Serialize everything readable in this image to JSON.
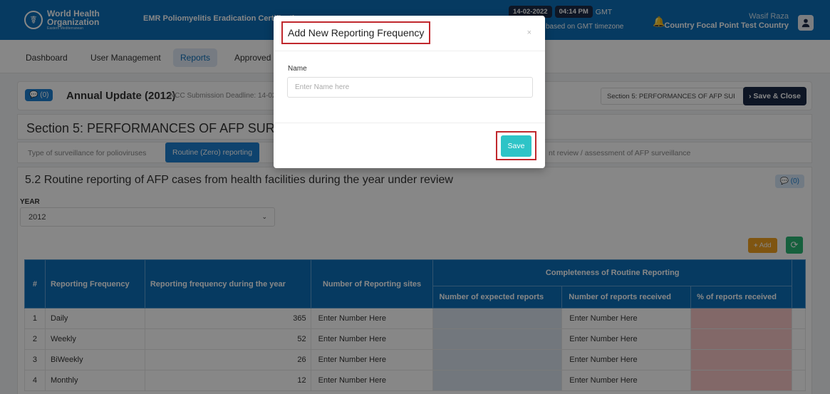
{
  "header": {
    "org_line1": "World Health",
    "org_line2": "Organization",
    "org_line3": "Eastern Mediterranean",
    "app_title": "EMR Poliomyelitis Eradication Certificatio",
    "date": "14-02-2022",
    "time": "04:14 PM",
    "tz": "GMT",
    "tz_note": "based on GMT timezone",
    "user_name": "Wasif Raza",
    "user_role": "Country Focal Point Test Country"
  },
  "nav": {
    "dashboard": "Dashboard",
    "user_management": "User Management",
    "reports": "Reports",
    "approved": "Approved R"
  },
  "report": {
    "comments_badge": "(0)",
    "title": "Annual Update (2012)",
    "deadline": "NCC Submission Deadline: 14-02",
    "section_select": "Section 5: PERFORMANCES OF AFP SUI",
    "save_close": "Save & Close",
    "section_title": "Section 5: PERFORMANCES OF AFP SURVEI",
    "tabs": {
      "t1": "Type of surveillance for polioviruses",
      "t2": "Routine (Zero) reporting",
      "t3": "nt review / assessment of AFP surveillance"
    }
  },
  "panel": {
    "title": "5.2 Routine reporting of AFP cases from health facilities during the year under review",
    "badge": "(0)",
    "year_label": "YEAR",
    "year_value": "2012",
    "add_label": "Add"
  },
  "table": {
    "headers": {
      "num": "#",
      "freq": "Reporting Frequency",
      "during": "Reporting frequency during the year",
      "sites": "Number of Reporting sites",
      "completeness": "Completeness of Routine Reporting",
      "expected": "Number of expected reports",
      "received": "Number of reports received",
      "pct": "% of reports received"
    },
    "placeholder": "Enter Number Here",
    "rows": [
      {
        "num": "1",
        "freq": "Daily",
        "count": "365"
      },
      {
        "num": "2",
        "freq": "Weekly",
        "count": "52"
      },
      {
        "num": "3",
        "freq": "BiWeekly",
        "count": "26"
      },
      {
        "num": "4",
        "freq": "Monthly",
        "count": "12"
      }
    ]
  },
  "modal": {
    "title": "Add New Reporting Frequency",
    "close": "×",
    "name_label": "Name",
    "name_placeholder": "Enter Name here",
    "save": "Save"
  },
  "colors": {
    "brand_blue": "#0d6fb8",
    "dark_navy": "#1b2a47",
    "highlight_red": "#c0282d",
    "save_teal": "#2ec4c7"
  }
}
